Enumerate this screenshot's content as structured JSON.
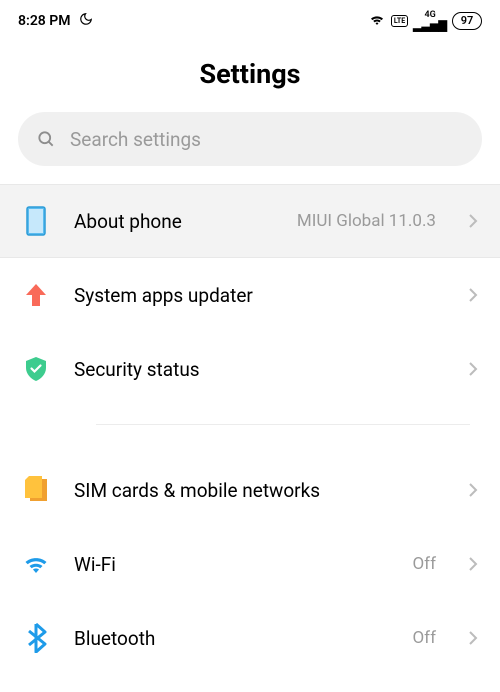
{
  "status_bar": {
    "time": "8:28 PM",
    "network_label": "4G",
    "lte_label": "LTE",
    "battery": "97"
  },
  "title": "Settings",
  "search": {
    "placeholder": "Search settings"
  },
  "rows": {
    "about": {
      "label": "About phone",
      "value": "MIUI Global 11.0.3"
    },
    "updater": {
      "label": "System apps updater"
    },
    "security": {
      "label": "Security status"
    },
    "sim": {
      "label": "SIM cards & mobile networks"
    },
    "wifi": {
      "label": "Wi-Fi",
      "value": "Off"
    },
    "bluetooth": {
      "label": "Bluetooth",
      "value": "Off"
    }
  }
}
